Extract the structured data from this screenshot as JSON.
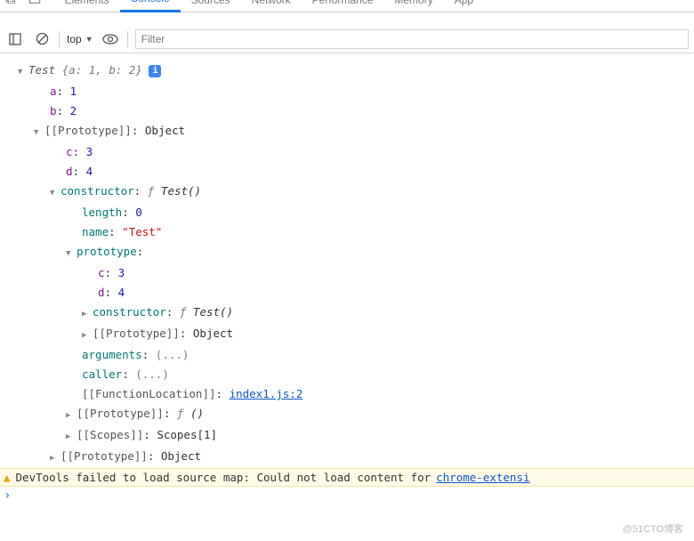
{
  "tabs": {
    "elements": "Elements",
    "console": "Console",
    "sources": "Sources",
    "network": "Network",
    "performance": "Performance",
    "memory": "Memory",
    "app": "App"
  },
  "toolbar": {
    "context": "top",
    "filter_placeholder": "Filter"
  },
  "obj": {
    "header_type": "Test ",
    "header_props": "{a: 1, b: 2}",
    "a": {
      "k": "a",
      "v": "1"
    },
    "b": {
      "k": "b",
      "v": "2"
    },
    "proto1": {
      "label": "[[Prototype]]",
      "val": "Object"
    },
    "c": {
      "k": "c",
      "v": "3"
    },
    "d": {
      "k": "d",
      "v": "4"
    },
    "ctor": {
      "k": "constructor",
      "f": "ƒ",
      "sig": "Test()"
    },
    "length": {
      "k": "length",
      "v": "0"
    },
    "name": {
      "k": "name",
      "v": "\"Test\""
    },
    "protoK": {
      "k": "prototype"
    },
    "pc": {
      "k": "c",
      "v": "3"
    },
    "pd": {
      "k": "d",
      "v": "4"
    },
    "pctor": {
      "k": "constructor",
      "f": "ƒ",
      "sig": "Test()"
    },
    "pproto": {
      "label": "[[Prototype]]",
      "val": "Object"
    },
    "args": {
      "k": "arguments",
      "v": "(...)"
    },
    "caller": {
      "k": "caller",
      "v": "(...)"
    },
    "funcloc": {
      "label": "[[FunctionLocation]]",
      "link": "index1.js:2"
    },
    "fproto": {
      "label": "[[Prototype]]",
      "f": "ƒ",
      "sig": "()"
    },
    "scopes": {
      "label": "[[Scopes]]",
      "val": "Scopes[1]"
    },
    "proto_last": {
      "label": "[[Prototype]]",
      "val": "Object"
    }
  },
  "warning": {
    "text": "DevTools failed to load source map: Could not load content for ",
    "link": "chrome-extensi"
  },
  "prompt": "›",
  "watermark": "@51CTO博客"
}
